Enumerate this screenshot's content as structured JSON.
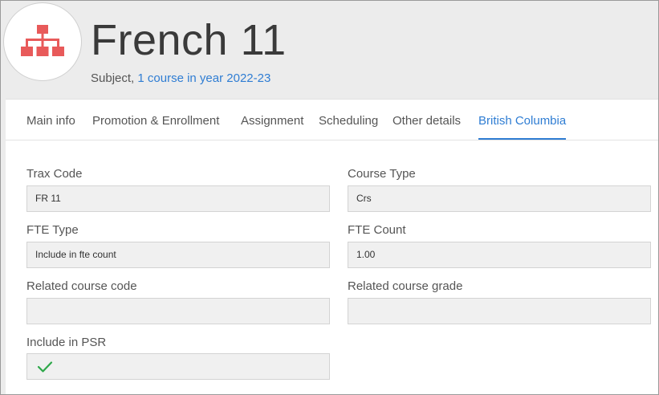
{
  "header": {
    "title": "French 11",
    "subtitle_prefix": "Subject,",
    "subtitle_link": "1 course in year 2022-23",
    "icon": "hierarchy-icon",
    "icon_color": "#e85a5a"
  },
  "tabs": [
    {
      "label": "Main info"
    },
    {
      "label": "Promotion & Enrollment"
    },
    {
      "label": "Assignment"
    },
    {
      "label": "Scheduling"
    },
    {
      "label": "Other details"
    },
    {
      "label": "British Columbia",
      "active": true
    }
  ],
  "accent_color": "#2f7dd3",
  "fields": {
    "trax_code": {
      "label": "Trax Code",
      "value": "FR 11"
    },
    "course_type": {
      "label": "Course Type",
      "value": "Crs"
    },
    "fte_type": {
      "label": "FTE Type",
      "value": "Include in fte count"
    },
    "fte_count": {
      "label": "FTE Count",
      "value": "1.00"
    },
    "related_code": {
      "label": "Related course code",
      "value": ""
    },
    "related_grade": {
      "label": "Related course grade",
      "value": ""
    },
    "include_psr": {
      "label": "Include in PSR",
      "checked": true,
      "icon": "check-icon",
      "check_color": "#2ea84a"
    }
  }
}
